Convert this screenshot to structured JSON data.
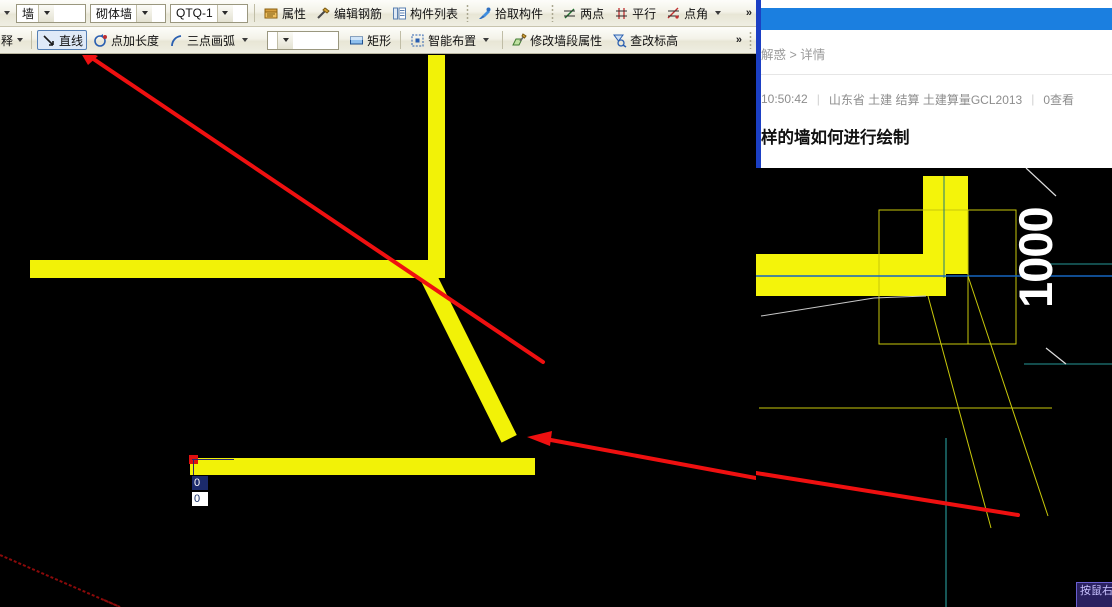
{
  "app": {
    "toolbar_row1": {
      "combos": [
        {
          "name": "category-combo",
          "value": "墙"
        },
        {
          "name": "type-combo",
          "value": "砌体墙"
        },
        {
          "name": "member-combo",
          "value": "QTQ-1"
        }
      ],
      "items": [
        {
          "name": "attribute-button",
          "label": "属性",
          "icon": "properties-icon"
        },
        {
          "name": "edit-rebar-button",
          "label": "编辑钢筋",
          "icon": "rebar-icon"
        },
        {
          "name": "member-list-button",
          "label": "构件列表",
          "icon": "list-icon"
        },
        {
          "name": "pick-member-button",
          "label": "拾取构件",
          "icon": "eyedropper-icon"
        },
        {
          "name": "two-point-button",
          "label": "两点",
          "icon": "two-point-icon"
        },
        {
          "name": "parallel-button",
          "label": "平行",
          "icon": "parallel-icon"
        },
        {
          "name": "point-angle-button",
          "label": "点角",
          "icon": "point-angle-icon"
        }
      ],
      "overflow": "»"
    },
    "toolbar_row2": {
      "lead_label": "释",
      "items": [
        {
          "name": "straight-line-button",
          "label": "直线",
          "icon": "line-icon",
          "active": true
        },
        {
          "name": "point-add-length-button",
          "label": "点加长度",
          "icon": "point-length-icon"
        },
        {
          "name": "three-point-arc-button",
          "label": "三点画弧",
          "icon": "arc-icon"
        }
      ],
      "blank_combo_value": "",
      "items2": [
        {
          "name": "rectangle-button",
          "label": "矩形",
          "icon": "rectangle-icon"
        },
        {
          "name": "smart-layout-button",
          "label": "智能布置",
          "icon": "smart-layout-icon"
        },
        {
          "name": "modify-wall-segment-button",
          "label": "修改墙段属性",
          "icon": "modify-wall-icon"
        },
        {
          "name": "check-elevation-button",
          "label": "查改标高",
          "icon": "elevation-icon"
        }
      ],
      "overflow": "»"
    },
    "canvas": {
      "name": "cad-drawing-canvas",
      "background_color": "#000000",
      "wall_color": "#F2F207",
      "annotation_color": "#EF1010",
      "inputs": [
        {
          "name": "length-input-active",
          "value": "0"
        },
        {
          "name": "angle-input",
          "value": "0"
        }
      ]
    }
  },
  "web": {
    "breadcrumb": "解惑 > 详情",
    "meta": {
      "time": "10:50:42",
      "tags": "山东省 土建 结算 土建算量GCL2013",
      "views": "0查看"
    },
    "title": "样的墙如何进行绘制",
    "embed": {
      "name": "question-image",
      "dimension_label": "1000"
    },
    "tooltip": "按鼠右\n让或按"
  },
  "colors": {
    "wall_yellow": "#F2F207",
    "arrow_red": "#EF1010",
    "browser_blue": "#1B7FE0",
    "scroll_blue": "#1B3FC4",
    "toolbar_bg": "#EFEEE2"
  }
}
